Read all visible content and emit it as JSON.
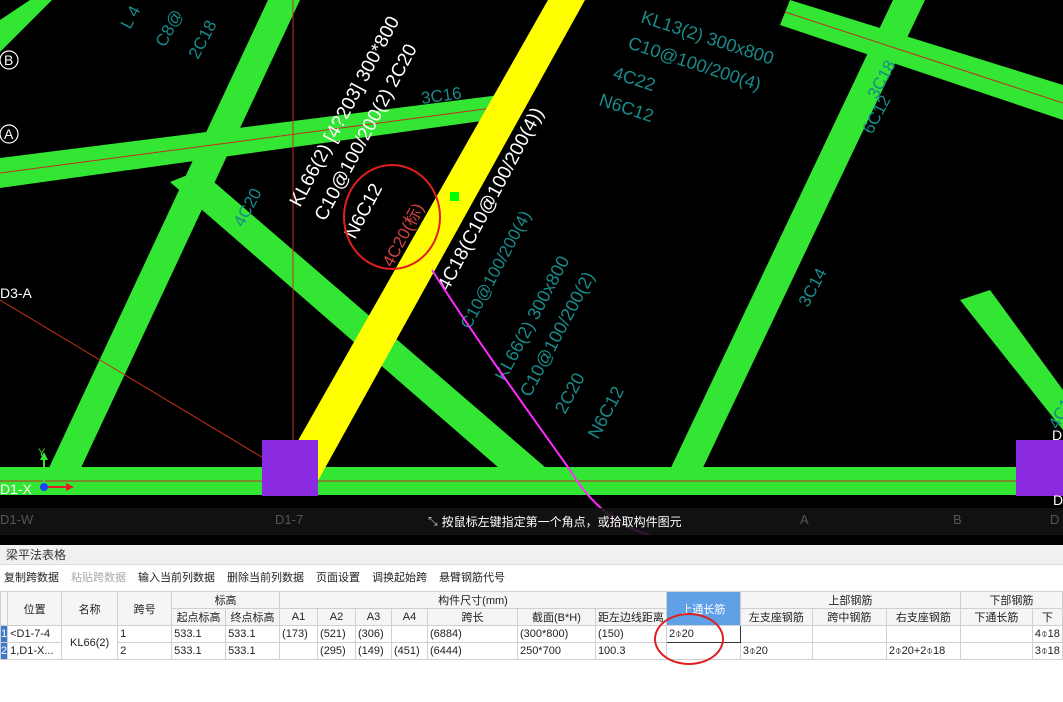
{
  "cad": {
    "labels": {
      "kl66_top": "KL66(2) [4?203] 300*800",
      "kl66_stirrup": "C10@100/200(2) 2C20",
      "kl66_n": "N6C12",
      "kl66_red": "4C20(标)",
      "c3c16": "3C16",
      "c4c20": "4C20",
      "big_beam": "4C18(C10@100/200(4))",
      "kl13_1": "KL13(2) 300x800",
      "kl13_2": "C10@100/200(4)",
      "kl13_3": "4C22",
      "kl13_4": "N6C12",
      "left1": "L 4",
      "left2": "C8@",
      "left3": "2C18",
      "r3c18": "3C18",
      "r6c12": "6C12",
      "mid_c10": "C10@100/200(4)",
      "kl66b_1": "KL66(2) 300x800",
      "kl66b_2": "C10@100/200(2)",
      "kl66b_3": "2C20",
      "kl66b_4": "N6C12",
      "c3c14": "3C14",
      "r4c1": "4C1",
      "axis_b": "B",
      "axis_a": "A",
      "axis_d3a": "D3-A",
      "axis_d1x": "D1-X",
      "axis_d": "D",
      "axis_d_right": "D",
      "axis_y": "Y"
    },
    "colors": {
      "beam_green": "#33e633",
      "beam_yellow": "#ffff00",
      "column_purple": "#8a2be2",
      "annot_cyan": "#1a8a8a",
      "text_white": "#ffffff",
      "arrow_magenta": "#ff2bff",
      "circle_red": "#e02020"
    }
  },
  "command_bar": {
    "hint": "按鼠标左键指定第一个角点，或拾取构件图元",
    "hint_icon": "crosshair-icon"
  },
  "bottom_axes": {
    "d1w": "D1-W",
    "d17": "D1-7",
    "a": "A",
    "b": "B",
    "d": "D"
  },
  "panel": {
    "title": "梁平法表格",
    "toolbar": [
      "复制跨数据",
      "粘贴跨数据",
      "输入当前列数据",
      "删除当前列数据",
      "页面设置",
      "调换起始跨",
      "悬臂钢筋代号"
    ],
    "toolbar_disabled": [
      1
    ],
    "headers_top": {
      "position": "位置",
      "name": "名称",
      "span": "跨号",
      "elev": "标高",
      "dims": "构件尺寸(mm)",
      "top_thru": "上通长筋",
      "top_rebar": "上部钢筋",
      "bot_rebar": "下部钢筋"
    },
    "headers_sub": [
      "起点标高",
      "终点标高",
      "A1",
      "A2",
      "A3",
      "A4",
      "跨长",
      "截面(B*H)",
      "距左边线距离",
      "左支座钢筋",
      "跨中钢筋",
      "右支座钢筋",
      "下通长筋",
      "下"
    ],
    "rows": [
      {
        "num": "1",
        "position": "<D1-7-4",
        "name": "KL66(2)",
        "span": "1",
        "start_elev": "533.1",
        "end_elev": "533.1",
        "a1": "(173)",
        "a2": "(521)",
        "a3": "(306)",
        "a4": "",
        "length": "(6884)",
        "section": "(300*800)",
        "offset": "(150)",
        "top_thru": "2⌽20",
        "left_support": "",
        "mid": "",
        "right_support": "",
        "bot_thru": "",
        "bot": "4⌽18"
      },
      {
        "num": "2",
        "position": "1,D1-X...",
        "name": "",
        "span": "2",
        "start_elev": "533.1",
        "end_elev": "533.1",
        "a1": "",
        "a2": "(295)",
        "a3": "(149)",
        "a4": "(451)",
        "length": "(6444)",
        "section": "250*700",
        "offset": "100.3",
        "top_thru": "",
        "left_support": "3⌽20",
        "mid": "",
        "right_support": "2⌽20+2⌽18",
        "bot_thru": "",
        "bot": "3⌽18"
      }
    ]
  }
}
